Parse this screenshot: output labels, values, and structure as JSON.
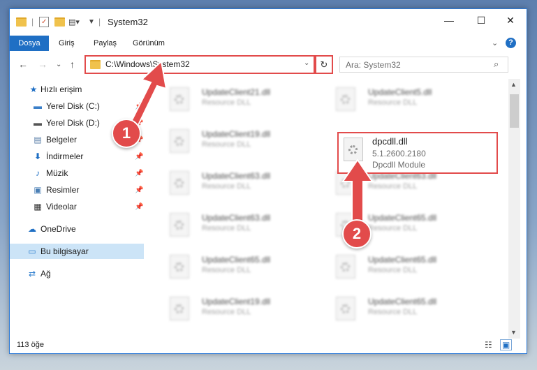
{
  "window": {
    "title": "System32",
    "quick_access_separator": "|",
    "controls": {
      "minimize": "—",
      "maximize": "☐",
      "close": "✕"
    }
  },
  "ribbon": {
    "tabs": [
      "Dosya",
      "Giriş",
      "Paylaş",
      "Görünüm"
    ],
    "collapse": "⌄",
    "help": "?"
  },
  "address_bar": {
    "path": "C:\\Windows\\System32",
    "search_placeholder": "Ara: System32"
  },
  "nav_pane": {
    "items": [
      {
        "label": "Hızlı erişim",
        "icon": "star-icon"
      },
      {
        "label": "Yerel Disk (C:)",
        "icon": "drive-icon"
      },
      {
        "label": "Yerel Disk (D:)",
        "icon": "drive-icon"
      },
      {
        "label": "Belgeler",
        "icon": "documents-icon"
      },
      {
        "label": "İndirmeler",
        "icon": "download-icon"
      },
      {
        "label": "Müzik",
        "icon": "music-icon"
      },
      {
        "label": "Resimler",
        "icon": "pictures-icon"
      },
      {
        "label": "Videolar",
        "icon": "videos-icon"
      },
      {
        "label": "OneDrive",
        "icon": "cloud-icon"
      },
      {
        "label": "Bu bilgisayar",
        "icon": "computer-icon"
      },
      {
        "label": "Ağ",
        "icon": "network-icon"
      }
    ]
  },
  "files": [
    {
      "name": "UpdateClient21.dll",
      "desc": "Resource DLL"
    },
    {
      "name": "UpdateClient5.dll",
      "desc": "Resource DLL"
    },
    {
      "name": "UpdateClient19.dll",
      "desc": "Resource DLL"
    },
    {
      "name": "UpdateClient63.dll",
      "desc": "Resource DLL"
    },
    {
      "name": "UpdateClient63.dll",
      "desc": "Resource DLL"
    },
    {
      "name": "UpdateClient63.dll",
      "desc": "Resource DLL"
    },
    {
      "name": "UpdateClient65.dll",
      "desc": "Resource DLL"
    },
    {
      "name": "UpdateClient65.dll",
      "desc": "Resource DLL"
    },
    {
      "name": "UpdateClient65.dll",
      "desc": "Resource DLL"
    },
    {
      "name": "UpdateClient19.dll",
      "desc": "Resource DLL"
    },
    {
      "name": "UpdateClient65.dll",
      "desc": "Resource DLL"
    }
  ],
  "target_file": {
    "name": "dpcdll.dll",
    "version": "5.1.2600.2180",
    "description": "Dpcdll Module"
  },
  "status_bar": {
    "item_count": "113 öğe"
  },
  "annotations": {
    "step1": "1",
    "step2": "2",
    "color": "#e24b4b"
  }
}
